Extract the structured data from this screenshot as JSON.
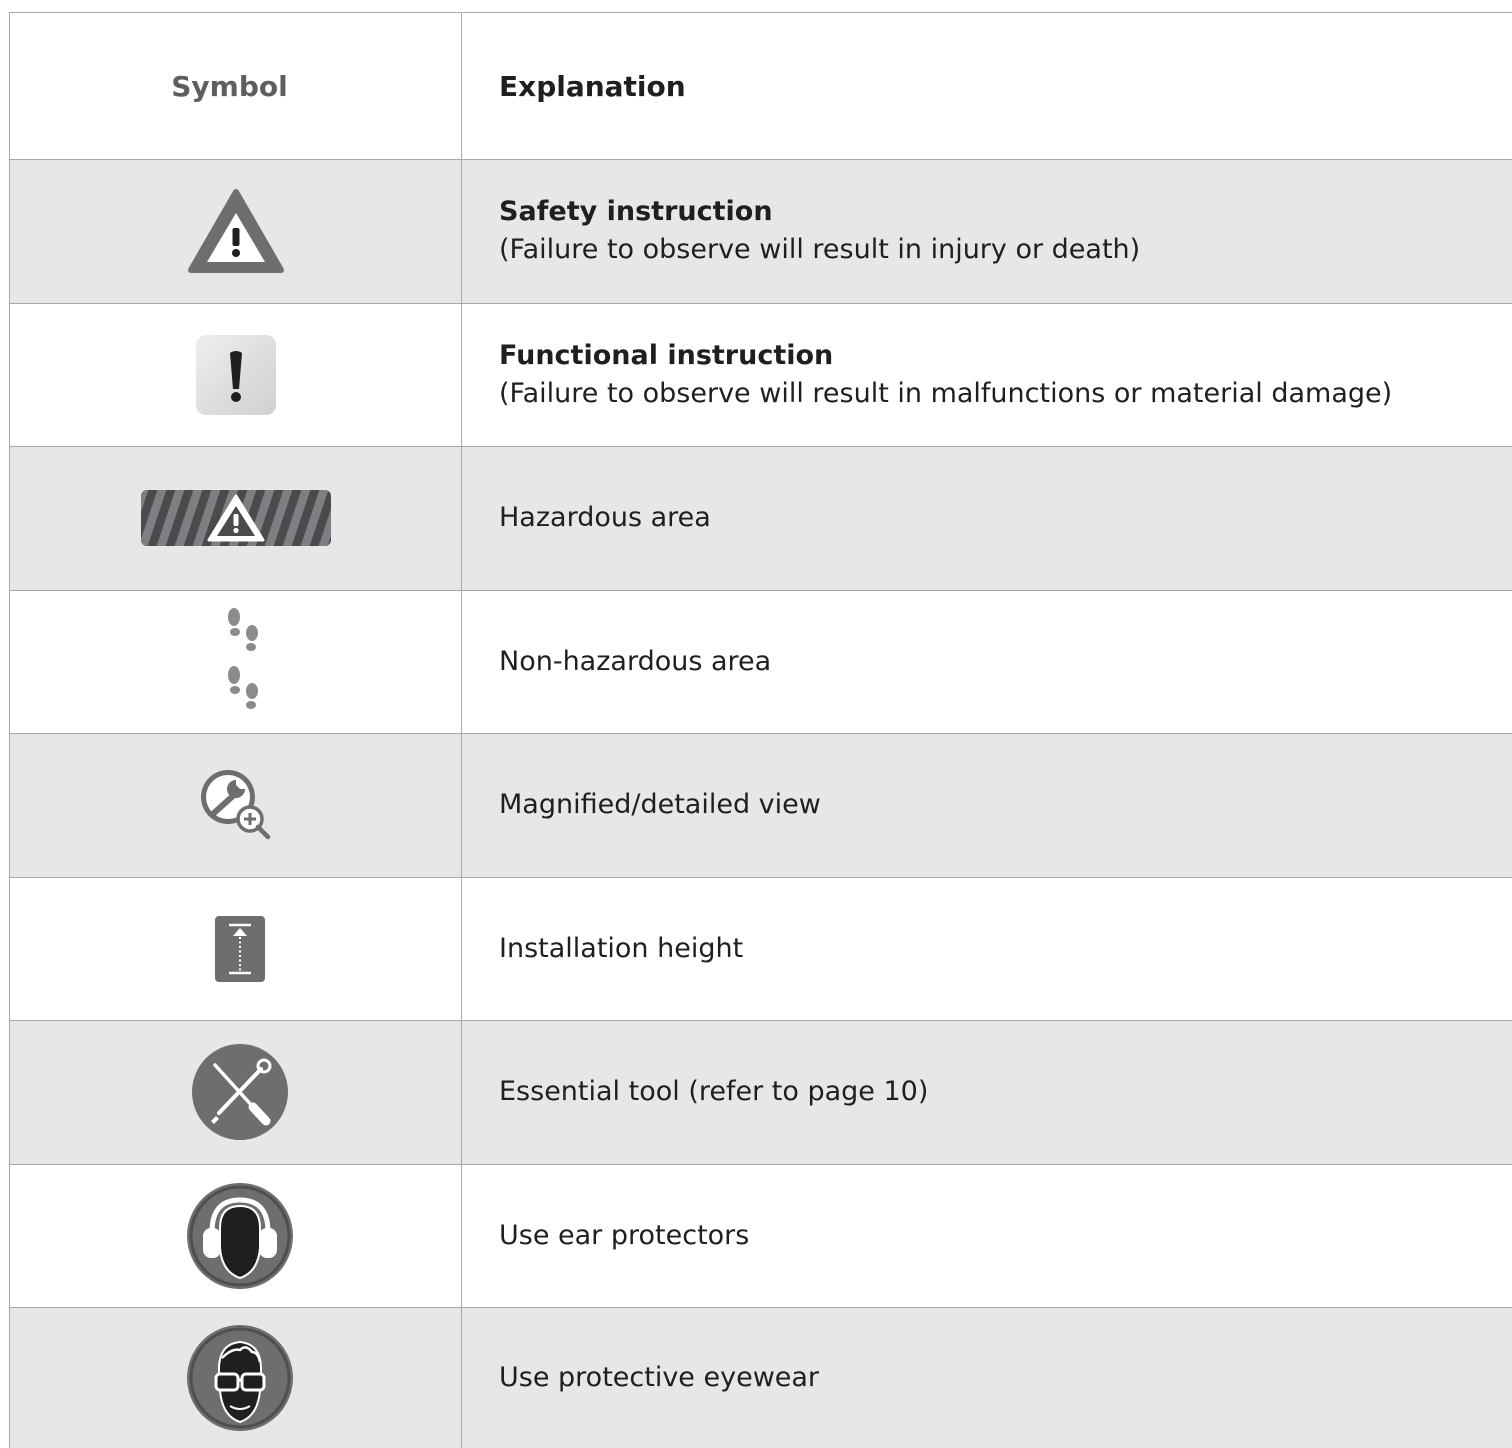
{
  "header": {
    "symbol": "Symbol",
    "explanation": "Explanation"
  },
  "rows": [
    {
      "icon": "safety-warning-triangle-icon",
      "title": "Safety instruction",
      "text": "(Failure to observe will result in injury or death)"
    },
    {
      "icon": "functional-exclamation-icon",
      "title": "Functional instruction",
      "text": "(Failure to observe will result in malfunctions or material damage)"
    },
    {
      "icon": "hazardous-area-stripes-icon",
      "text": "Hazardous area"
    },
    {
      "icon": "footprints-icon",
      "text": "Non-hazardous area"
    },
    {
      "icon": "magnifier-wrench-icon",
      "text": "Magnified/detailed view"
    },
    {
      "icon": "installation-height-icon",
      "text": "Installation height"
    },
    {
      "icon": "tools-crossed-icon",
      "text": "Essential tool (refer to page 10)"
    },
    {
      "icon": "ear-protectors-icon",
      "text": "Use ear protectors"
    },
    {
      "icon": "protective-eyewear-icon",
      "text": "Use protective eyewear"
    }
  ],
  "colors": {
    "icon_gray": "#6d6e70",
    "row_shade": "#e6e7e9",
    "rule": "#a9a9a9"
  }
}
